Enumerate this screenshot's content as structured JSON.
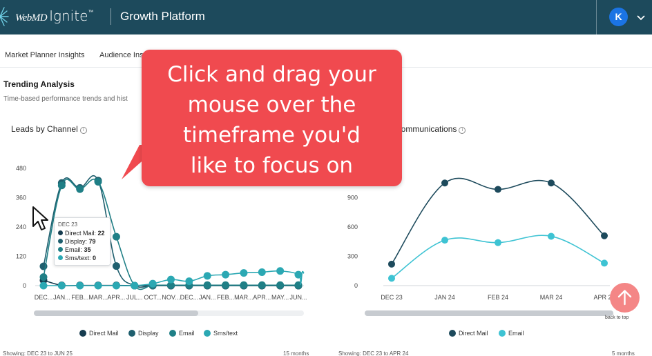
{
  "header": {
    "brand_webmd": "WebMD",
    "brand_ignite": "Ignite",
    "brand_tm": "™",
    "app_name": "Growth Platform",
    "avatar_initial": "K",
    "colors": {
      "background": "#1d4a5c",
      "avatar": "#1b74e4"
    }
  },
  "tabs": [
    {
      "label": "Market Planner Insights"
    },
    {
      "label": "Audience Ins"
    }
  ],
  "section": {
    "title": "Trending Analysis",
    "subtitle": "Time-based performance trends and hist"
  },
  "callout": {
    "text_lines": [
      "Click and drag your",
      "mouse over the",
      "timeframe you'd",
      "like to focus on"
    ],
    "color": "#f04a4f"
  },
  "chart_data": [
    {
      "type": "line",
      "title": "Leads by Channel",
      "categories": [
        "DEC...",
        "JAN...",
        "FEB...",
        "MAR...",
        "APR...",
        "JUL...",
        "OCT...",
        "NOV...",
        "DEC...",
        "JAN...",
        "FEB...",
        "MAR...",
        "APR...",
        "MAY...",
        "JUN..."
      ],
      "y_ticks": [
        0,
        120,
        240,
        360,
        480
      ],
      "ylim": [
        0,
        480
      ],
      "series": [
        {
          "name": "Direct Mail",
          "color": "#163c4f",
          "values": [
            22,
            1,
            1,
            1,
            1,
            0,
            0,
            0,
            0,
            0,
            0,
            0,
            0,
            0,
            0
          ]
        },
        {
          "name": "Display",
          "color": "#1f5f6e",
          "values": [
            79,
            420,
            400,
            430,
            80,
            0,
            0,
            0,
            0,
            0,
            0,
            0,
            0,
            0,
            0
          ]
        },
        {
          "name": "Email",
          "color": "#1f7f86",
          "values": [
            35,
            410,
            395,
            425,
            200,
            0,
            2,
            2,
            2,
            2,
            2,
            2,
            2,
            2,
            2
          ]
        },
        {
          "name": "Sms/text",
          "color": "#2ba8b3",
          "values": [
            0,
            0,
            0,
            0,
            0,
            0,
            8,
            25,
            18,
            40,
            45,
            52,
            55,
            60,
            45
          ],
          "extra_points": [
            {
              "x_offset": 0.4,
              "value": 5
            },
            {
              "x_offset": 0.7,
              "value": 55
            },
            {
              "x_offset": 1.0,
              "value": 50
            }
          ]
        }
      ],
      "legend": [
        "Direct Mail",
        "Display",
        "Email",
        "Sms/text"
      ],
      "legend_position": "bottom",
      "footer_left": "Showing: DEC 23 to JUN 25",
      "footer_right": "15 months",
      "tooltip": {
        "date": "DEC 23",
        "rows": [
          {
            "label": "Direct Mail",
            "value": "22"
          },
          {
            "label": "Display",
            "value": "79"
          },
          {
            "label": "Email",
            "value": "35"
          },
          {
            "label": "Sms/text",
            "value": "0"
          }
        ]
      }
    },
    {
      "type": "line",
      "title": "Communications",
      "categories": [
        "DEC 23",
        "JAN 24",
        "FEB 24",
        "MAR 24",
        "APR 24"
      ],
      "y_ticks": [
        0,
        300,
        600,
        900
      ],
      "ylim": [
        0,
        1200
      ],
      "series": [
        {
          "name": "Direct Mail",
          "color": "#1d4a5c",
          "values": [
            220,
            1050,
            985,
            1050,
            510
          ]
        },
        {
          "name": "Email",
          "color": "#3ec3d3",
          "values": [
            75,
            465,
            440,
            505,
            230
          ]
        }
      ],
      "legend": [
        "Direct Mail",
        "Email"
      ],
      "legend_position": "bottom",
      "footer_left": "Showing: DEC 23 to APR 24",
      "footer_right": "5 months"
    }
  ],
  "back_to_top": {
    "label": "back to top",
    "color": "#f48686"
  }
}
